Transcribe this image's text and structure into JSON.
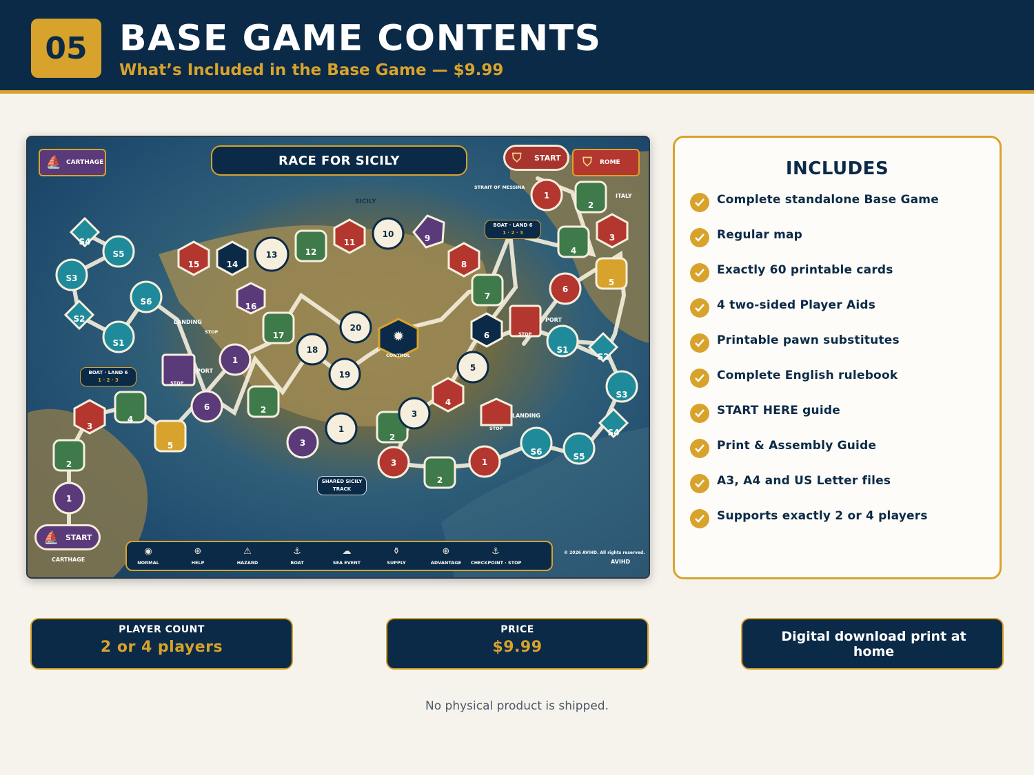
{
  "header": {
    "number": "05",
    "title": "BASE GAME CONTENTS",
    "subtitle": "What’s Included in the Base Game — $9.99"
  },
  "map": {
    "title": "RACE FOR SICILY",
    "carthage_tag": "CARTHAGE",
    "rome_tag": "ROME",
    "start_rome": "START",
    "start_carthage": "START",
    "carthage_label": "CARTHAGE",
    "strait": "STRAIT OF MESSINA",
    "sicily": "SICILY",
    "italy": "ITALY",
    "boat_land_right": "BOAT · LAND 6",
    "boat_land_left": "BOAT · LAND 6",
    "boat_land_sub": "1 · 2 · 3",
    "shared_track": "SHARED SICILY TRACK",
    "control": "CONTROL",
    "port": "PORT",
    "landing": "LANDING",
    "stop": "STOP",
    "legend": [
      "NORMAL",
      "HELP",
      "HAZARD",
      "BOAT",
      "SEA EVENT",
      "SUPPLY",
      "ADVANTAGE",
      "CHECKPOINT · STOP"
    ],
    "copyright": "© 2026 AVIHD. All rights reserved.",
    "brand": "AVIHD",
    "colors": {
      "red": "#b3362f",
      "green": "#3f7a4a",
      "purple": "#5b3a7a",
      "teal": "#1f8a9a",
      "navy": "#0b2a47",
      "gold": "#d8a32c",
      "cream": "#f6efdd"
    }
  },
  "includes": {
    "title": "INCLUDES",
    "items": [
      "Complete standalone Base Game",
      "Regular map",
      "Exactly 60 printable cards",
      "4 two-sided Player Aids",
      "Printable pawn substitutes",
      "Complete English rulebook",
      "START HERE guide",
      "Print & Assembly Guide",
      "A3, A4 and US Letter files",
      "Supports exactly 2 or 4 players"
    ]
  },
  "stats": {
    "player_label": "PLAYER COUNT",
    "player_value": "2 or 4 players",
    "price_label": "PRICE",
    "price_value": "$9.99",
    "download_text": "Digital download print at home"
  },
  "footnote": "No physical product is shipped."
}
